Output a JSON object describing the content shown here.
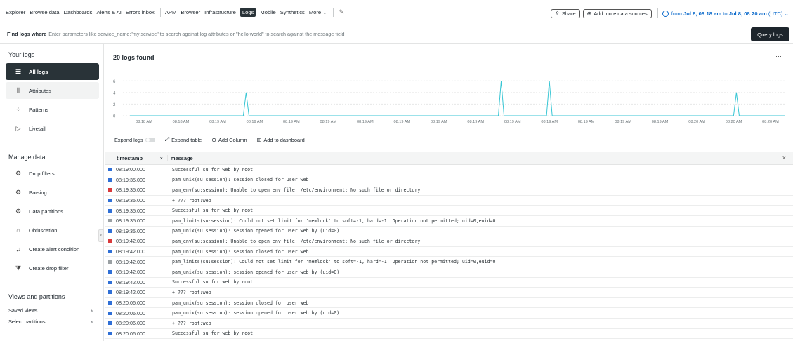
{
  "topnav": {
    "items": [
      "Explorer",
      "Browse data",
      "Dashboards",
      "Alerts & AI",
      "Errors inbox"
    ],
    "items2": [
      "APM",
      "Browser",
      "Infrastructure",
      "Logs",
      "Mobile",
      "Synthetics",
      "More ⌄"
    ],
    "share_label": "Share",
    "add_sources_label": "Add more data sources",
    "time_prefix": "from",
    "time_start": "Jul 8, 08:18 am",
    "time_to": "to",
    "time_end": "Jul 8, 08:20 am",
    "time_suffix": "(UTC) ⌄"
  },
  "query": {
    "label": "Find logs where",
    "placeholder": "Enter parameters like service_name:\"my service\" to search against log attributes or \"hello world\" to search against the message field",
    "button_label": "Query logs"
  },
  "sidebar": {
    "your_logs_heading": "Your logs",
    "your_logs": [
      {
        "label": "All logs",
        "icon": "list-icon"
      },
      {
        "label": "Attributes",
        "icon": "bar-chart-icon"
      },
      {
        "label": "Patterns",
        "icon": "patterns-icon"
      },
      {
        "label": "Livetail",
        "icon": "play-icon"
      }
    ],
    "manage_heading": "Manage data",
    "manage": [
      {
        "label": "Drop filters",
        "icon": "gear-icon"
      },
      {
        "label": "Parsing",
        "icon": "gear-icon"
      },
      {
        "label": "Data partitions",
        "icon": "gear-icon"
      },
      {
        "label": "Obfuscation",
        "icon": "lock-icon"
      },
      {
        "label": "Create alert condition",
        "icon": "bell-icon"
      },
      {
        "label": "Create drop filter",
        "icon": "filter-icon"
      }
    ],
    "views_heading": "Views and partitions",
    "saved_views": "Saved views",
    "select_partitions": "Select partitions"
  },
  "main": {
    "title": "20 logs found"
  },
  "chart_data": {
    "type": "line",
    "y_ticks": [
      "6",
      "4",
      "2",
      "0"
    ],
    "ylim": [
      0,
      7
    ],
    "x_tick_labels": [
      "08:18 AM",
      "08:18 AM",
      "08:19 AM",
      "08:19 AM",
      "08:19 AM",
      "08:19 AM",
      "08:19 AM",
      "08:19 AM",
      "08:19 AM",
      "08:19 AM",
      "08:19 AM",
      "08:19 AM",
      "08:19 AM",
      "08:19 AM",
      "08:19 AM",
      "08:20 AM",
      "08:20 AM",
      "08:20 AM"
    ],
    "values": [
      0,
      0,
      0,
      0,
      0,
      0,
      0,
      0,
      0,
      0,
      0,
      0,
      0,
      0,
      0,
      0,
      0,
      0,
      0,
      0,
      0,
      0,
      0,
      0,
      0,
      0,
      0,
      0,
      0,
      0,
      0,
      0,
      0,
      0,
      0,
      0,
      0,
      0,
      0,
      0,
      0,
      4,
      0,
      0,
      0,
      0,
      0,
      0,
      0,
      0,
      0,
      0,
      0,
      0,
      0,
      0,
      0,
      0,
      0,
      0,
      0,
      0,
      0,
      0,
      0,
      0,
      0,
      0,
      0,
      0,
      0,
      0,
      0,
      0,
      0,
      0,
      0,
      0,
      0,
      0,
      0,
      0,
      0,
      0,
      0,
      0,
      0,
      0,
      0,
      0,
      0,
      0,
      0,
      0,
      0,
      0,
      0,
      0,
      0,
      0,
      0,
      0,
      0,
      0,
      0,
      0,
      0,
      0,
      0,
      0,
      0,
      0,
      0,
      0,
      0,
      0,
      0,
      0,
      0,
      0,
      0,
      0,
      0,
      0,
      0,
      0,
      0,
      0,
      0,
      0,
      0,
      6,
      0,
      0,
      0,
      0,
      0,
      0,
      0,
      0,
      0,
      0,
      0,
      0,
      0,
      0,
      0,
      0,
      6,
      0,
      0,
      0,
      0,
      0,
      0,
      0,
      0,
      0,
      0,
      0,
      0,
      0,
      0,
      0,
      0,
      0,
      0,
      0,
      0,
      0,
      0,
      0,
      0,
      0,
      0,
      0,
      0,
      0,
      0,
      0,
      0,
      0,
      0,
      0,
      0,
      0,
      0,
      0,
      0,
      0,
      0,
      0,
      0,
      0,
      0,
      0,
      0,
      0,
      0,
      0,
      0,
      0,
      0,
      0,
      0,
      0,
      0,
      0,
      0,
      0,
      0,
      0,
      0,
      0,
      4,
      0,
      0,
      0,
      0,
      0,
      0,
      0,
      0,
      0,
      0,
      0,
      0,
      0,
      0,
      0,
      0,
      0
    ],
    "color": "#38c6d4",
    "grid": true
  },
  "toolbar": {
    "expand_logs": "Expand logs",
    "expand_table": "Expand table",
    "add_column": "Add Column",
    "add_dashboard": "Add to dashboard"
  },
  "table": {
    "col_timestamp": "timestamp",
    "col_message": "message",
    "rows": [
      {
        "ts": "08:19:00.000",
        "msg": "Successful su for web by root",
        "level": "#2f6fd6"
      },
      {
        "ts": "08:19:35.000",
        "msg": "pam_unix(su:session): session closed for user web",
        "level": "#2f6fd6"
      },
      {
        "ts": "08:19:35.000",
        "msg": "pam_env(su:session): Unable to open env file: /etc/environment: No such file or directory",
        "level": "#d9393b"
      },
      {
        "ts": "08:19:35.000",
        "msg": "+ ??? root:web",
        "level": "#2f6fd6"
      },
      {
        "ts": "08:19:35.000",
        "msg": "Successful su for web by root",
        "level": "#2f6fd6"
      },
      {
        "ts": "08:19:35.000",
        "msg": "pam_limits(su:session): Could not set limit for 'memlock' to soft=-1, hard=-1: Operation not permitted; uid=0,euid=0",
        "level": "#9aa0a3"
      },
      {
        "ts": "08:19:35.000",
        "msg": "pam_unix(su:session): session opened for user web by (uid=0)",
        "level": "#2f6fd6"
      },
      {
        "ts": "08:19:42.000",
        "msg": "pam_env(su:session): Unable to open env file: /etc/environment: No such file or directory",
        "level": "#d9393b"
      },
      {
        "ts": "08:19:42.000",
        "msg": "pam_unix(su:session): session closed for user web",
        "level": "#2f6fd6"
      },
      {
        "ts": "08:19:42.000",
        "msg": "pam_limits(su:session): Could not set limit for 'memlock' to soft=-1, hard=-1: Operation not permitted; uid=0,euid=0",
        "level": "#9aa0a3"
      },
      {
        "ts": "08:19:42.000",
        "msg": "pam_unix(su:session): session opened for user web by (uid=0)",
        "level": "#2f6fd6"
      },
      {
        "ts": "08:19:42.000",
        "msg": "Successful su for web by root",
        "level": "#2f6fd6"
      },
      {
        "ts": "08:19:42.000",
        "msg": "+ ??? root:web",
        "level": "#2f6fd6"
      },
      {
        "ts": "08:20:06.000",
        "msg": "pam_unix(su:session): session closed for user web",
        "level": "#2f6fd6"
      },
      {
        "ts": "08:20:06.000",
        "msg": "pam_unix(su:session): session opened for user web by (uid=0)",
        "level": "#2f6fd6"
      },
      {
        "ts": "08:20:06.000",
        "msg": "+ ??? root:web",
        "level": "#2f6fd6"
      },
      {
        "ts": "08:20:06.000",
        "msg": "Successful su for web by root",
        "level": "#2f6fd6"
      }
    ]
  }
}
